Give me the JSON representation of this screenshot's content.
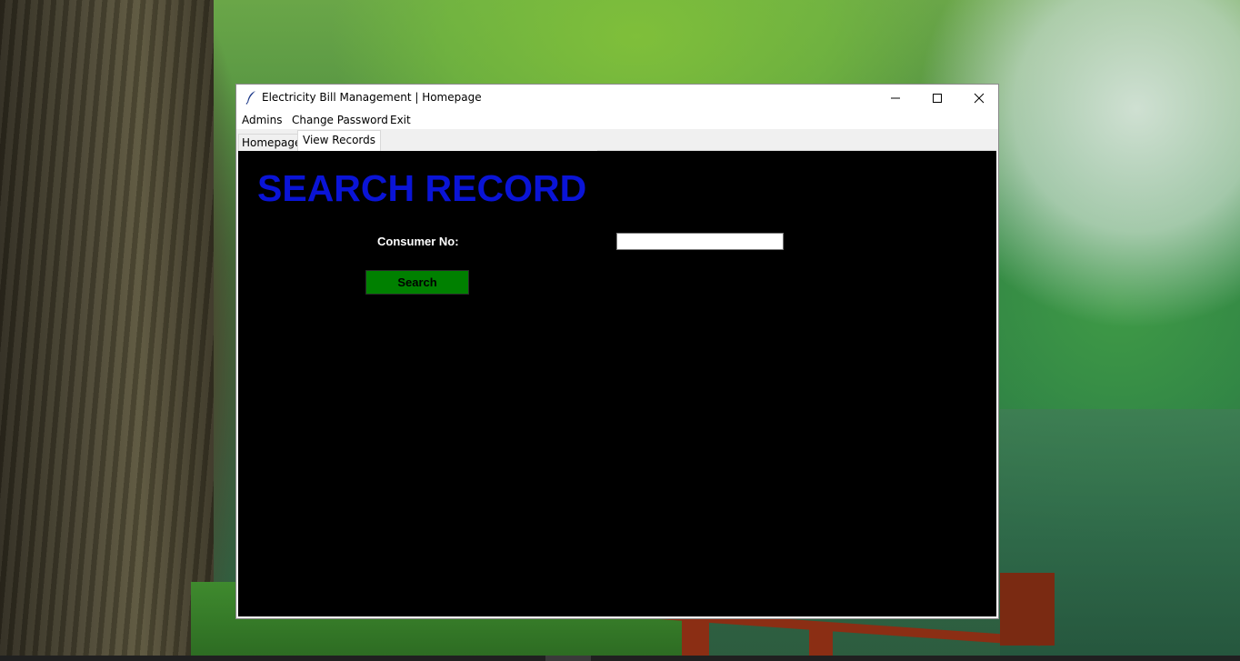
{
  "window": {
    "title": "Electricity Bill Management | Homepage",
    "controls": {
      "minimize_icon": "minimize-icon",
      "maximize_icon": "maximize-icon",
      "close_icon": "close-icon"
    }
  },
  "menu": {
    "items": [
      {
        "label": "Admins"
      },
      {
        "label": "Change Password"
      },
      {
        "label": "Exit"
      }
    ]
  },
  "tabs": [
    {
      "label": "Homepage",
      "selected": false
    },
    {
      "label": "View Records",
      "selected": true
    }
  ],
  "search_panel": {
    "heading": "SEARCH RECORD",
    "consumer_label": "Consumer No:",
    "consumer_value": "",
    "search_label": "Search"
  },
  "colors": {
    "panel_background": "#000000",
    "heading": "#0a14d6",
    "search_button": "#008000",
    "label_text": "#ffffff"
  }
}
